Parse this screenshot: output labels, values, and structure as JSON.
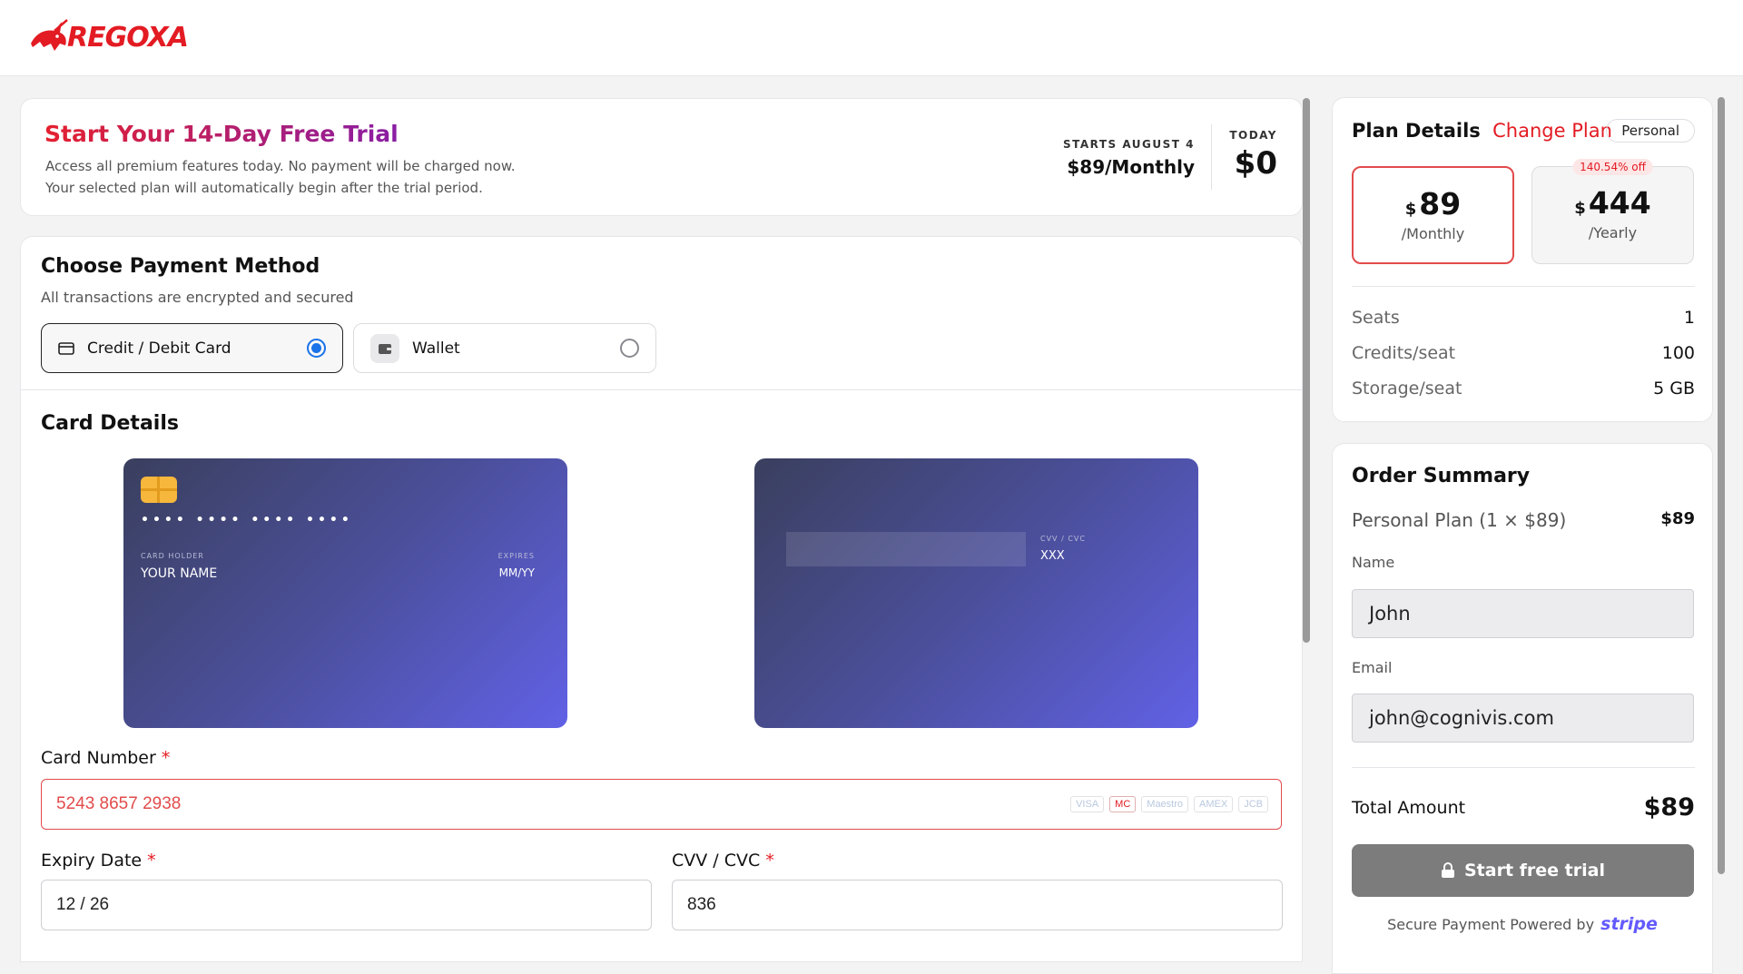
{
  "brand": {
    "name": "REGOXA",
    "color": "#e31b23"
  },
  "trial": {
    "title": "Start Your 14-Day Free Trial",
    "line1": "Access all premium features today. No payment will be charged now.",
    "line2": "Your selected plan will automatically begin after the trial period.",
    "starts_label": "STARTS AUGUST 4",
    "starts_value": "$89/Monthly",
    "today_label": "TODAY",
    "today_value": "$0"
  },
  "payment": {
    "title": "Choose Payment Method",
    "subtitle": "All transactions are encrypted and secured",
    "methods": [
      {
        "label": "Credit / Debit Card",
        "icon": "credit-card-icon",
        "selected": true
      },
      {
        "label": "Wallet",
        "icon": "wallet-icon",
        "selected": false
      }
    ],
    "accent": "#1a73e8"
  },
  "card_details": {
    "title": "Card Details",
    "preview_front": {
      "number_mask": "•••• •••• •••• ••••",
      "holder_label": "CARD HOLDER",
      "holder_value": "YOUR NAME",
      "expires_label": "EXPIRES",
      "expires_value": "MM/YY"
    },
    "preview_back": {
      "cvv_label": "CVV / CVC",
      "cvv_value": "XXX"
    },
    "card_number": {
      "label": "Card Number",
      "required_mark": "*",
      "value": "5243 8657 2938",
      "brands": [
        "VISA",
        "MC",
        "Maestro",
        "AMEX",
        "JCB"
      ],
      "detected_brand": "MC",
      "error_color": "#e24b4b"
    },
    "expiry": {
      "label": "Expiry Date",
      "required_mark": "*",
      "value": "12 / 26"
    },
    "cvv": {
      "label": "CVV / CVC",
      "required_mark": "*",
      "value": "836"
    }
  },
  "plan": {
    "title": "Plan Details",
    "change_link": "Change Plan",
    "badge": "Personal",
    "options": [
      {
        "currency": "$",
        "amount": "89",
        "period": "/Monthly",
        "selected": true,
        "discount": ""
      },
      {
        "currency": "$",
        "amount": "444",
        "period": "/Yearly",
        "selected": false,
        "discount": "140.54% off"
      }
    ],
    "specs": [
      {
        "key": "Seats",
        "value": "1"
      },
      {
        "key": "Credits/seat",
        "value": "100"
      },
      {
        "key": "Storage/seat",
        "value": "5 GB"
      }
    ]
  },
  "order": {
    "title": "Order Summary",
    "line_label": "Personal Plan (1 × $89)",
    "line_value": "$89",
    "name_label": "Name",
    "name_value": "John",
    "email_label": "Email",
    "email_value": "john@cognivis.com",
    "total_label": "Total Amount",
    "total_value": "$89",
    "cta_label": "Start free trial",
    "secure_text": "Secure Payment Powered by",
    "secure_brand": "stripe",
    "secure_brand_color": "#635bff"
  }
}
